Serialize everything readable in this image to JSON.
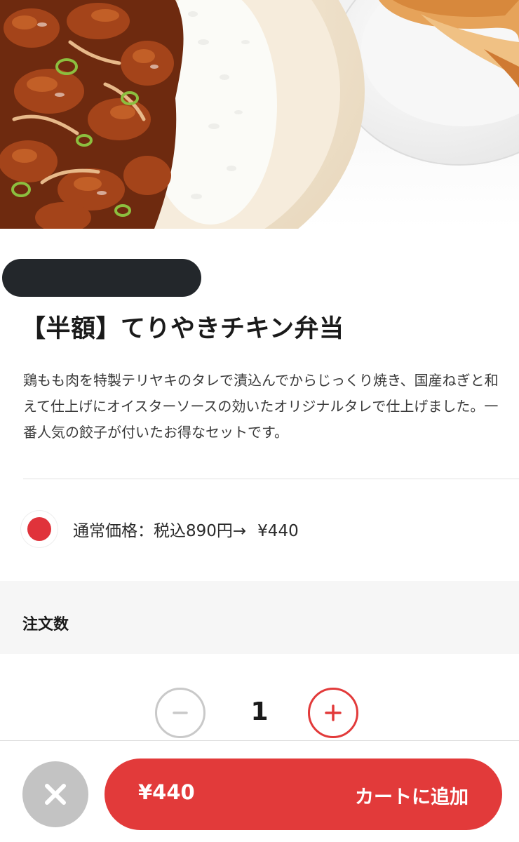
{
  "product": {
    "title": "【半額】てりやきチキン弁当",
    "description": "鶏もも肉を特製テリヤキのタレで漬込んでからじっくり焼き、国産ねぎと和えて仕上げにオイスターソースの効いたオリジナルタレで仕上げました。一番人気の餃子が付いたお得なセットです。",
    "price_label": "通常価格：税込890円→",
    "sale_price": "¥440"
  },
  "order": {
    "label": "注文数",
    "quantity": "1"
  },
  "cart": {
    "price": "¥440",
    "add_label": "カートに追加"
  },
  "icons": {
    "flag": "japan-flag-icon",
    "minus": "minus-icon",
    "plus": "plus-icon",
    "close": "close-icon"
  },
  "colors": {
    "accent": "#e23a3a",
    "close_button": "#c3c3c3",
    "redacted": "#23272b",
    "order_band": "#f6f6f6"
  }
}
